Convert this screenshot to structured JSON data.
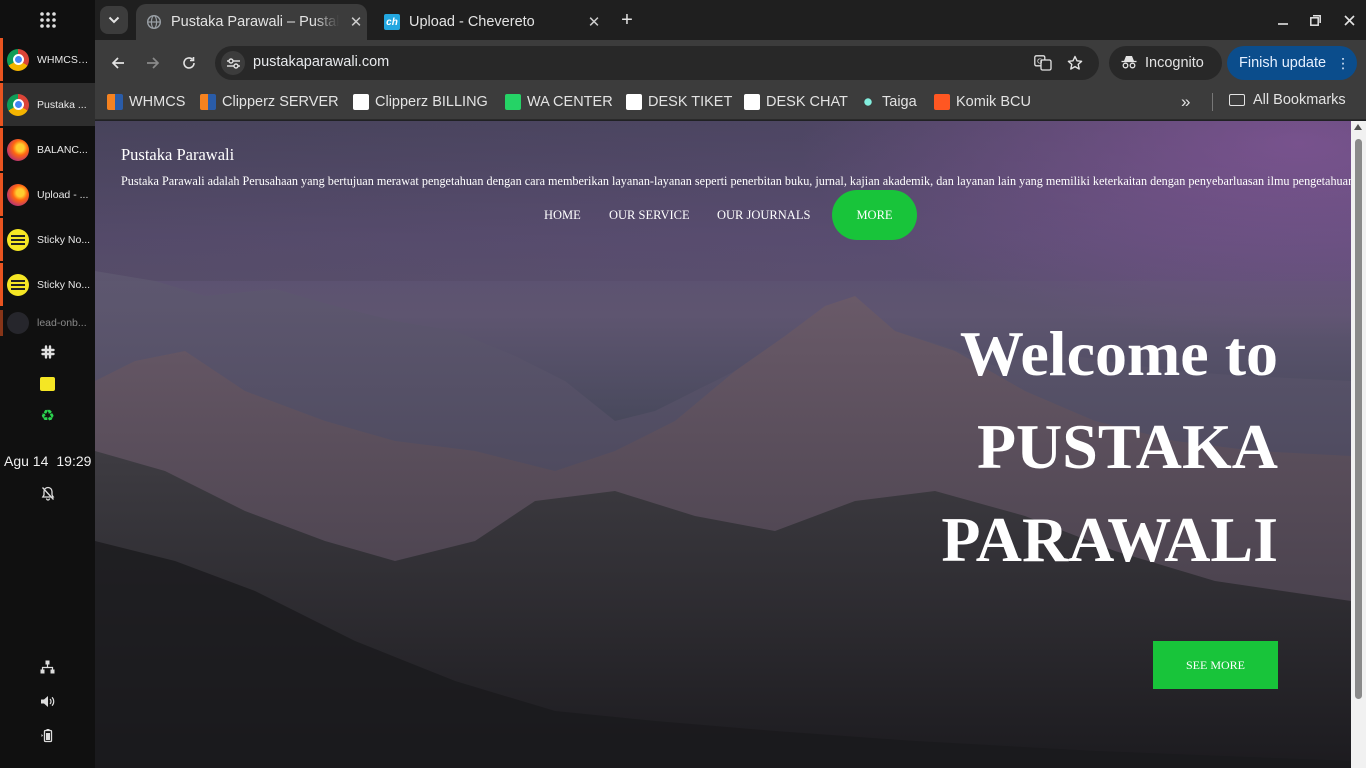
{
  "dock": {
    "windows": [
      {
        "label": "WHMCS - ...",
        "icon": "chrome-icon"
      },
      {
        "label": "Pustaka ...",
        "icon": "chrome-icon"
      },
      {
        "label": "BALANC...",
        "icon": "firefox-icon"
      },
      {
        "label": "Upload - ...",
        "icon": "firefox-icon"
      },
      {
        "label": "Sticky No...",
        "icon": "sticky-notes-icon"
      },
      {
        "label": "Sticky No...",
        "icon": "sticky-notes-icon"
      },
      {
        "label": "lead-onb...",
        "icon": "app-icon"
      }
    ],
    "tray_icons": [
      "slack-icon",
      "sticky-notes-icon",
      "recycle-icon"
    ],
    "date": "Agu 14",
    "time": "19:29",
    "bottom_icons": [
      "network-icon",
      "volume-icon",
      "battery-icon"
    ]
  },
  "browser": {
    "tabs": [
      {
        "title": "Pustaka Parawali – Pustaka Parawali",
        "active": true
      },
      {
        "title": "Upload - Chevereto",
        "active": false,
        "favicon_text": "ch"
      }
    ],
    "url": "pustakaparawali.com",
    "incognito_label": "Incognito",
    "update_label": "Finish update",
    "bookmarks": [
      {
        "label": "WHMCS"
      },
      {
        "label": "Clipperz SERVER"
      },
      {
        "label": "Clipperz BILLING"
      },
      {
        "label": "WA CENTER"
      },
      {
        "label": "DESK TIKET"
      },
      {
        "label": "DESK CHAT"
      },
      {
        "label": "Taiga"
      },
      {
        "label": "Komik BCU"
      }
    ],
    "all_bookmarks_label": "All Bookmarks"
  },
  "page": {
    "site_title": "Pustaka Parawali",
    "site_description": "Pustaka Parawali adalah Perusahaan yang bertujuan merawat pengetahuan dengan cara memberikan layanan-layanan seperti penerbitan buku, jurnal, kajian akademik, dan layanan lain yang memiliki keterkaitan dengan penyebarluasan ilmu pengetahuan",
    "menu": [
      "HOME",
      "OUR SERVICE",
      "OUR JOURNALS",
      "MORE"
    ],
    "hero_lines": [
      "Welcome to",
      "PUSTAKA",
      "PARAWALI"
    ],
    "cta_label": "SEE MORE",
    "accent_color": "#18c43a"
  }
}
